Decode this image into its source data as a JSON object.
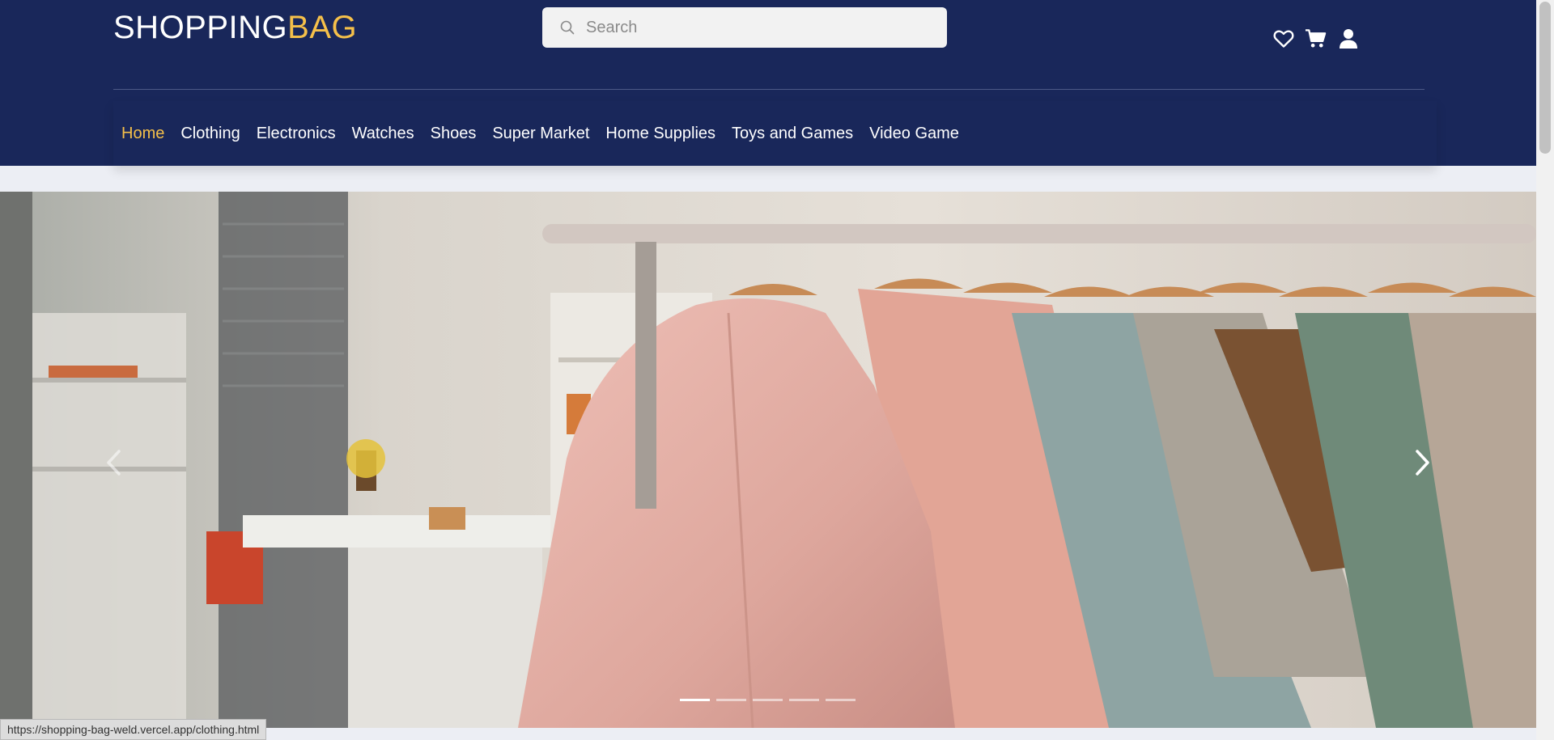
{
  "header": {
    "logo_main": "SHOPPING",
    "logo_accent": "BAG",
    "search_placeholder": "Search",
    "icons": [
      "heart-icon",
      "cart-icon",
      "user-icon"
    ]
  },
  "nav": {
    "items": [
      "Home",
      "Clothing",
      "Electronics",
      "Watches",
      "Shoes",
      "Super Market",
      "Home Supplies",
      "Toys and Games",
      "Video Game"
    ],
    "active": "Home"
  },
  "carousel": {
    "slide_count": 5,
    "active_slide": 1
  },
  "status_bar": {
    "url": "https://shopping-bag-weld.vercel.app/clothing.html"
  },
  "colors": {
    "header_bg": "#19275a",
    "accent": "#f5c04a",
    "page_bg": "#eceef4"
  }
}
